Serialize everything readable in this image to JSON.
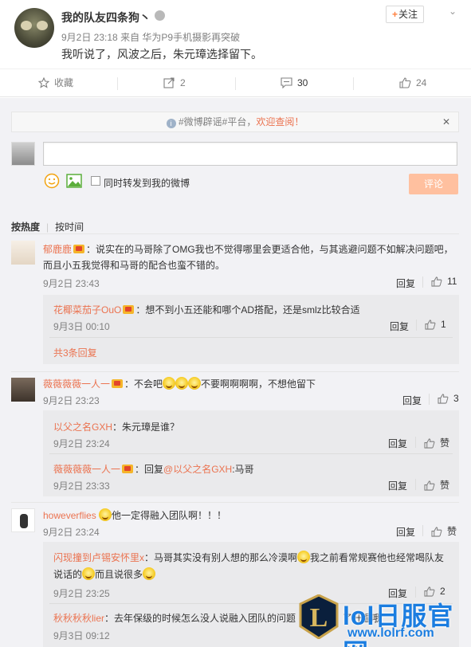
{
  "post": {
    "author": "我的队友四条狗丶",
    "follow_label": "关注",
    "follow_plus": "+",
    "chevron": "⌄",
    "date": "9月2日 23:18",
    "source_prefix": "来自",
    "source": "华为P9手机摄影再突破",
    "text": "我听说了，风波之后，朱元璋选择留下。"
  },
  "actions": {
    "favorite_label": "收藏",
    "repost_count": "2",
    "comment_count": "30",
    "like_count": "24"
  },
  "notice": {
    "topic1": "#微博辟谣#",
    "mid": "平台，",
    "welcome": "欢迎查阅！",
    "close": "✕"
  },
  "composer": {
    "checkbox_label": "同时转发到我的微博",
    "submit_label": "评论"
  },
  "sort": {
    "hot": "按热度",
    "time": "按时间"
  },
  "comments": [
    {
      "name": "郁鹿鹿",
      "line1": "：说实在的马哥除了OMG我也不觉得哪里会更适合他，与其逃避问题不如解决问题吧，",
      "line2": "而且小五我觉得和马哥的配合也蛮不错的。",
      "date": "9月2日 23:43",
      "reply": "回复",
      "likes": "11",
      "subs": [
        {
          "name": "花椰菜茄子OuO",
          "text": "：想不到小五还能和哪个AD搭配，还是smlz比较合适",
          "date": "9月3日 00:10",
          "reply": "回复",
          "likes": "1"
        }
      ],
      "more": "共3条回复"
    },
    {
      "name": "薇薇薇薇一人一",
      "text_a": "：不会吧",
      "text_b": "不要啊啊啊啊，不想他留下",
      "date": "9月2日 23:23",
      "reply": "回复",
      "likes": "3",
      "subs": [
        {
          "name": "以父之名GXH",
          "text": "：朱元璋是谁？",
          "date": "9月2日 23:24",
          "reply": "回复",
          "likes": "赞"
        },
        {
          "name": "薇薇薇薇一人一",
          "text_pre": "：回复",
          "mention": "@以父之名GXH",
          "text": ":马哥",
          "date": "9月2日 23:33",
          "reply": "回复",
          "likes": "赞"
        }
      ]
    },
    {
      "name": "howeverflies",
      "text": "他一定得融入团队啊！！！",
      "date": "9月2日 23:24",
      "reply": "回复",
      "likes": "赞",
      "subs": [
        {
          "name": "闪现撞到卢锡安怀里x",
          "text_a": "：马哥其实没有别人想的那么冷漠啊",
          "text_b": "我之前看常规赛他也经常喝队友",
          "line2_a": "说话的",
          "line2_b": "而且说很多",
          "date": "9月2日 23:25",
          "reply": "回复",
          "likes": "2"
        },
        {
          "name": "秋秋秋秋lier",
          "text": "：去年保级的时候怎么没人说融入团队的问题",
          "text_tail": "了升温哦",
          "date": "9月3日 09:12"
        }
      ]
    }
  ],
  "watermark": {
    "title": "lol日服官网",
    "url": "www.lolrf.com",
    "logo_letter": "L"
  },
  "colors": {
    "accent": "#eb7350",
    "submit_bg": "#ffc09f",
    "watermark": "#1b7de0"
  }
}
